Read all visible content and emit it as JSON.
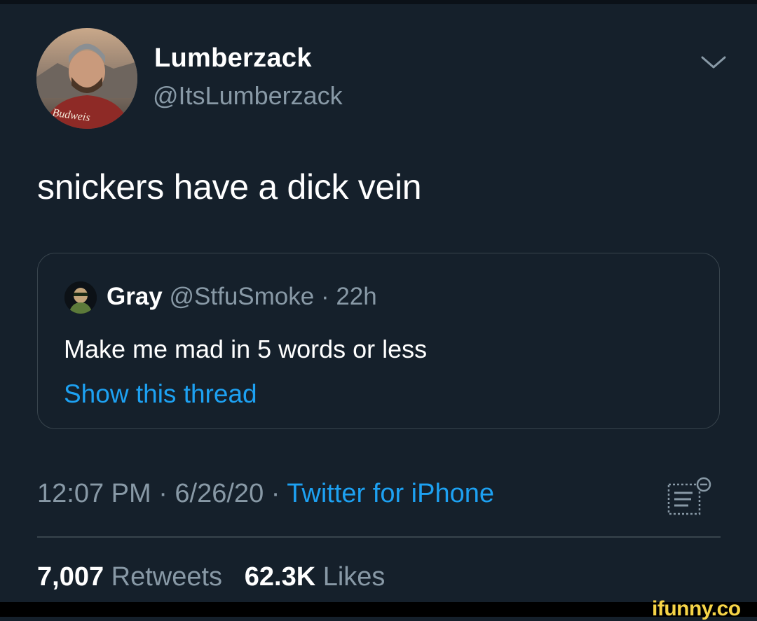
{
  "tweet": {
    "display_name": "Lumberzack",
    "handle": "@ItsLumberzack",
    "text": "snickers have a dick vein",
    "avatar_shirt_text": "Budweis",
    "timestamp": "12:07 PM · 6/26/20 · ",
    "source": "Twitter for iPhone"
  },
  "quote": {
    "name": "Gray",
    "meta": " @StfuSmoke · 22h",
    "text": "Make me mad in 5 words or less",
    "show_thread": "Show this thread"
  },
  "stats": {
    "retweets_count": "7,007",
    "retweets_label": " Retweets",
    "likes_count": "62.3K",
    "likes_label": " Likes"
  },
  "watermark": "ifunny.co",
  "icons": {
    "menu": "chevron-down-icon",
    "analytics": "tweet-analytics-icon"
  },
  "colors": {
    "background": "#15202b",
    "link": "#1da1f2",
    "secondary_text": "#8899a6",
    "border": "#38444d",
    "watermark": "#f6d447"
  }
}
